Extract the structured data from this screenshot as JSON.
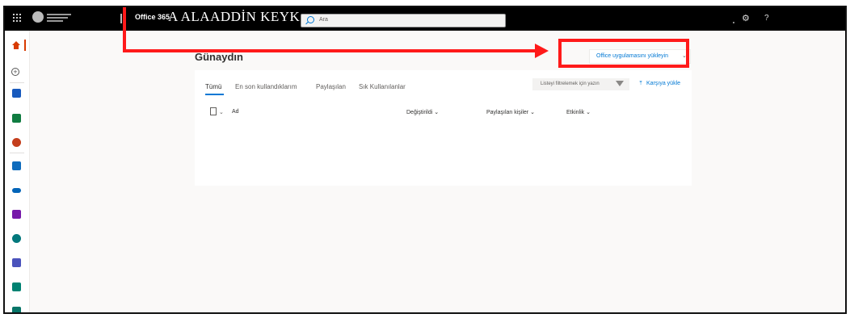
{
  "topbar": {
    "app_name": "Office 365",
    "org_name": "A ALAADDİN KEYK",
    "search_placeholder": "Ara",
    "settings_icon": "gear-icon",
    "help_label": "?"
  },
  "rail": {
    "items": [
      {
        "name": "home",
        "icon": "home-icon",
        "color": "#d83b01",
        "active": true
      },
      {
        "name": "create",
        "icon": "plus-icon"
      },
      {
        "name": "word",
        "icon": "word-icon",
        "color": "#185abd"
      },
      {
        "name": "excel",
        "icon": "excel-icon",
        "color": "#107c41"
      },
      {
        "name": "powerpoint",
        "icon": "powerpoint-icon",
        "color": "#c43e1c"
      },
      {
        "name": "outlook",
        "icon": "outlook-icon",
        "color": "#0f6cbd"
      },
      {
        "name": "onedrive",
        "icon": "onedrive-icon",
        "color": "#0364b8"
      },
      {
        "name": "onenote",
        "icon": "onenote-icon",
        "color": "#7719aa"
      },
      {
        "name": "sharepoint",
        "icon": "sharepoint-icon",
        "color": "#03787c"
      },
      {
        "name": "teams",
        "icon": "teams-icon",
        "color": "#4b53bc"
      },
      {
        "name": "sway",
        "icon": "sway-icon",
        "color": "#008272"
      },
      {
        "name": "forms",
        "icon": "forms-icon",
        "color": "#077568"
      }
    ]
  },
  "main": {
    "greeting": "Günaydın",
    "install_button": "Office uygulamasını yükleyin",
    "tabs": [
      "Tümü",
      "En son kullandıklarım",
      "Paylaşılan",
      "Sık Kullanılanlar"
    ],
    "filter_placeholder": "Listeyi filtrelemek için yazın",
    "upload_label": "Karşıya yükle",
    "columns": {
      "name": "Ad",
      "modified": "Değiştirildi",
      "shared_with": "Paylaşılan kişiler",
      "activity": "Etkinlik"
    }
  },
  "accent_color": "#0078d4",
  "annotation_color": "#ff1a1a"
}
